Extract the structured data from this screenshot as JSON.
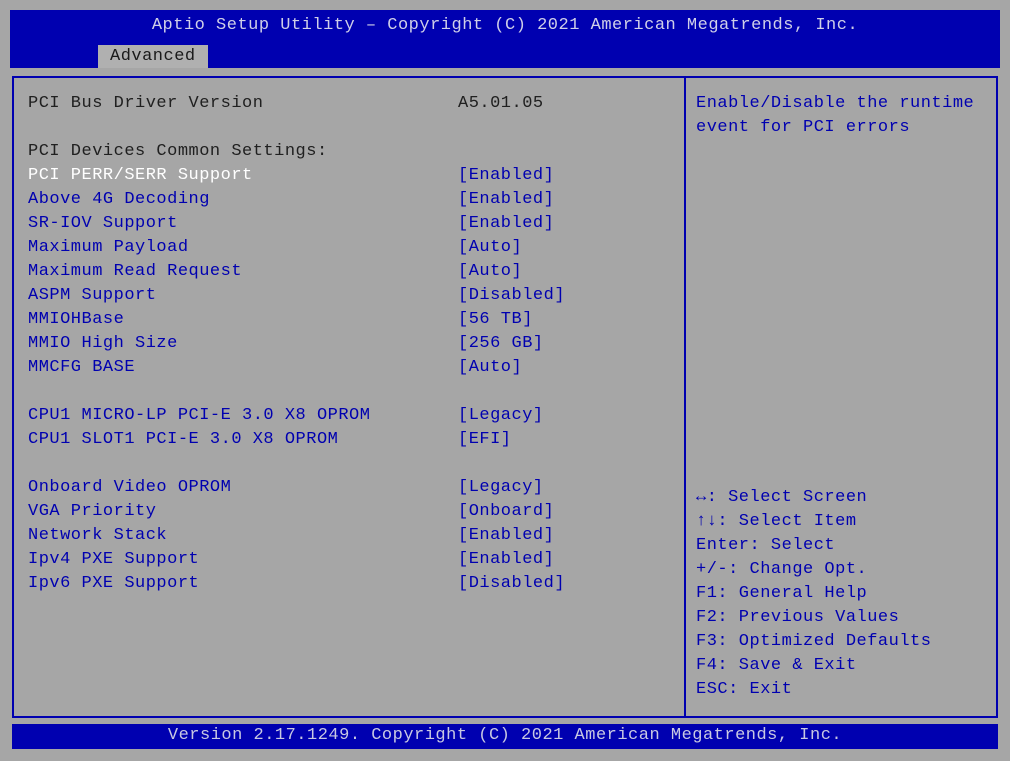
{
  "header": {
    "title": "Aptio Setup Utility – Copyright (C) 2021 American Megatrends, Inc.",
    "active_tab": "Advanced"
  },
  "left_panel": {
    "version_label": "PCI Bus Driver Version",
    "version_value": "A5.01.05",
    "section_label": "PCI Devices Common Settings:",
    "settings": [
      {
        "label": "PCI PERR/SERR Support",
        "value": "[Enabled]",
        "selected": true
      },
      {
        "label": "Above 4G Decoding",
        "value": "[Enabled]",
        "selected": false
      },
      {
        "label": "SR-IOV Support",
        "value": "[Enabled]",
        "selected": false
      },
      {
        "label": "Maximum Payload",
        "value": "[Auto]",
        "selected": false
      },
      {
        "label": "Maximum Read Request",
        "value": "[Auto]",
        "selected": false
      },
      {
        "label": "ASPM Support",
        "value": "[Disabled]",
        "selected": false
      },
      {
        "label": "MMIOHBase",
        "value": "[56 TB]",
        "selected": false
      },
      {
        "label": "MMIO High Size",
        "value": "[256 GB]",
        "selected": false
      },
      {
        "label": "MMCFG BASE",
        "value": "[Auto]",
        "selected": false
      }
    ],
    "slot_settings": [
      {
        "label": "CPU1 MICRO-LP PCI-E 3.0 X8 OPROM",
        "value": "[Legacy]"
      },
      {
        "label": "CPU1 SLOT1 PCI-E 3.0 X8 OPROM",
        "value": "[EFI]"
      }
    ],
    "misc_settings": [
      {
        "label": "Onboard Video OPROM",
        "value": "[Legacy]"
      },
      {
        "label": "VGA Priority",
        "value": "[Onboard]"
      },
      {
        "label": "Network Stack",
        "value": "[Enabled]"
      },
      {
        "label": "Ipv4 PXE Support",
        "value": "[Enabled]"
      },
      {
        "label": "Ipv6 PXE Support",
        "value": "[Disabled]"
      }
    ]
  },
  "right_panel": {
    "help_text": "Enable/Disable the runtime event for PCI errors",
    "key_help": [
      {
        "glyph": "↔",
        "text": ": Select Screen"
      },
      {
        "glyph": "↑↓",
        "text": ": Select Item"
      },
      {
        "glyph": "Enter",
        "text": ": Select"
      },
      {
        "glyph": "+/-",
        "text": ": Change Opt."
      },
      {
        "glyph": "F1",
        "text": ": General Help"
      },
      {
        "glyph": "F2",
        "text": ": Previous Values"
      },
      {
        "glyph": "F3",
        "text": ": Optimized Defaults"
      },
      {
        "glyph": "F4",
        "text": ": Save & Exit"
      },
      {
        "glyph": "ESC",
        "text": ": Exit"
      }
    ]
  },
  "footer": {
    "text": "Version 2.17.1249. Copyright (C) 2021 American Megatrends, Inc."
  }
}
